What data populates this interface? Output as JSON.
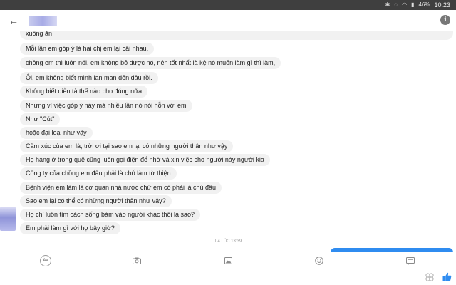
{
  "status_bar": {
    "battery": "46%",
    "time": "10:23"
  },
  "header": {
    "contact_name": "",
    "back_icon": "arrow-left-icon",
    "info_icon": "info-icon"
  },
  "messages": [
    "xuống ăn",
    "Mỗi lần em góp ý là hai chị em lại cãi nhau,",
    "chồng em thì luôn nói, em không bỏ được nó, nên tốt nhất là kệ nó muốn làm gì thì làm,",
    "Ôi, em không biết mình lan man đến đâu rồi.",
    "Không biết diễn tả thế nào cho đúng nữa",
    "Nhưng vì việc góp ý này mà nhiều lần nó nói hỗn với em",
    "Như \"Cút\"",
    "hoặc đại loại như vậy",
    "Cảm xúc của em là, trời ơi tại sao em lại có những người thân như vậy",
    "Họ hàng ở trong quê cũng luôn gọi điện để nhờ vả xin việc cho người này người kia",
    "Công ty của chồng em đâu phải là chỗ làm từ thiện",
    "Bệnh viện em làm là cơ quan nhà nước chứ em có phải là chủ đâu",
    "Sao em lại có thể có những người thân như vậy?",
    "Họ chỉ luôn tìm cách sống bám vào người khác thôi là sao?",
    "Em phải làm gì với họ bây giờ?"
  ],
  "timestamp": "T.4 LÚC 13:39",
  "composer": {
    "text_style_label": "Aa",
    "camera_icon": "camera-icon",
    "image_icon": "image-icon",
    "emoji_icon": "emoji-icon",
    "message_icon": "message-icon"
  },
  "nav": {
    "game_icon": "game-icon",
    "like_icon": "thumbs-up-icon"
  },
  "colors": {
    "bubble_incoming": "#f1f1f1",
    "bubble_outgoing": "#2f8cf0",
    "like": "#2f8cf0"
  }
}
